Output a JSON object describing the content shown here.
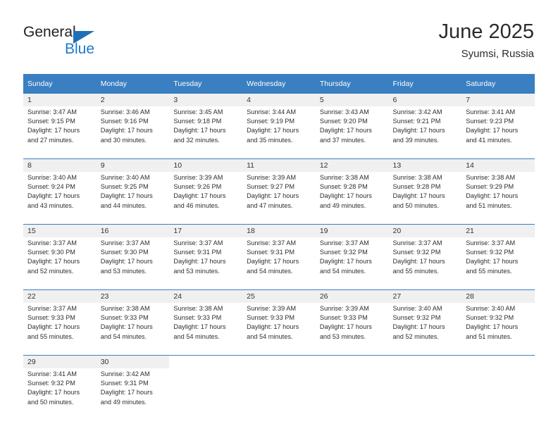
{
  "brand": {
    "name_part1": "General",
    "name_part2": "Blue",
    "flag_icon": "triangle-flag-icon"
  },
  "header": {
    "title": "June 2025",
    "subtitle": "Syumsi, Russia"
  },
  "calendar": {
    "weekday_headers": [
      "Sunday",
      "Monday",
      "Tuesday",
      "Wednesday",
      "Thursday",
      "Friday",
      "Saturday"
    ],
    "accent_color": "#3a7fc1",
    "daynum_bg": "#f0f0f0",
    "weeks": [
      {
        "days": [
          {
            "num": "1",
            "sunrise": "Sunrise: 3:47 AM",
            "sunset": "Sunset: 9:15 PM",
            "daylight1": "Daylight: 17 hours",
            "daylight2": "and 27 minutes."
          },
          {
            "num": "2",
            "sunrise": "Sunrise: 3:46 AM",
            "sunset": "Sunset: 9:16 PM",
            "daylight1": "Daylight: 17 hours",
            "daylight2": "and 30 minutes."
          },
          {
            "num": "3",
            "sunrise": "Sunrise: 3:45 AM",
            "sunset": "Sunset: 9:18 PM",
            "daylight1": "Daylight: 17 hours",
            "daylight2": "and 32 minutes."
          },
          {
            "num": "4",
            "sunrise": "Sunrise: 3:44 AM",
            "sunset": "Sunset: 9:19 PM",
            "daylight1": "Daylight: 17 hours",
            "daylight2": "and 35 minutes."
          },
          {
            "num": "5",
            "sunrise": "Sunrise: 3:43 AM",
            "sunset": "Sunset: 9:20 PM",
            "daylight1": "Daylight: 17 hours",
            "daylight2": "and 37 minutes."
          },
          {
            "num": "6",
            "sunrise": "Sunrise: 3:42 AM",
            "sunset": "Sunset: 9:21 PM",
            "daylight1": "Daylight: 17 hours",
            "daylight2": "and 39 minutes."
          },
          {
            "num": "7",
            "sunrise": "Sunrise: 3:41 AM",
            "sunset": "Sunset: 9:23 PM",
            "daylight1": "Daylight: 17 hours",
            "daylight2": "and 41 minutes."
          }
        ]
      },
      {
        "days": [
          {
            "num": "8",
            "sunrise": "Sunrise: 3:40 AM",
            "sunset": "Sunset: 9:24 PM",
            "daylight1": "Daylight: 17 hours",
            "daylight2": "and 43 minutes."
          },
          {
            "num": "9",
            "sunrise": "Sunrise: 3:40 AM",
            "sunset": "Sunset: 9:25 PM",
            "daylight1": "Daylight: 17 hours",
            "daylight2": "and 44 minutes."
          },
          {
            "num": "10",
            "sunrise": "Sunrise: 3:39 AM",
            "sunset": "Sunset: 9:26 PM",
            "daylight1": "Daylight: 17 hours",
            "daylight2": "and 46 minutes."
          },
          {
            "num": "11",
            "sunrise": "Sunrise: 3:39 AM",
            "sunset": "Sunset: 9:27 PM",
            "daylight1": "Daylight: 17 hours",
            "daylight2": "and 47 minutes."
          },
          {
            "num": "12",
            "sunrise": "Sunrise: 3:38 AM",
            "sunset": "Sunset: 9:28 PM",
            "daylight1": "Daylight: 17 hours",
            "daylight2": "and 49 minutes."
          },
          {
            "num": "13",
            "sunrise": "Sunrise: 3:38 AM",
            "sunset": "Sunset: 9:28 PM",
            "daylight1": "Daylight: 17 hours",
            "daylight2": "and 50 minutes."
          },
          {
            "num": "14",
            "sunrise": "Sunrise: 3:38 AM",
            "sunset": "Sunset: 9:29 PM",
            "daylight1": "Daylight: 17 hours",
            "daylight2": "and 51 minutes."
          }
        ]
      },
      {
        "days": [
          {
            "num": "15",
            "sunrise": "Sunrise: 3:37 AM",
            "sunset": "Sunset: 9:30 PM",
            "daylight1": "Daylight: 17 hours",
            "daylight2": "and 52 minutes."
          },
          {
            "num": "16",
            "sunrise": "Sunrise: 3:37 AM",
            "sunset": "Sunset: 9:30 PM",
            "daylight1": "Daylight: 17 hours",
            "daylight2": "and 53 minutes."
          },
          {
            "num": "17",
            "sunrise": "Sunrise: 3:37 AM",
            "sunset": "Sunset: 9:31 PM",
            "daylight1": "Daylight: 17 hours",
            "daylight2": "and 53 minutes."
          },
          {
            "num": "18",
            "sunrise": "Sunrise: 3:37 AM",
            "sunset": "Sunset: 9:31 PM",
            "daylight1": "Daylight: 17 hours",
            "daylight2": "and 54 minutes."
          },
          {
            "num": "19",
            "sunrise": "Sunrise: 3:37 AM",
            "sunset": "Sunset: 9:32 PM",
            "daylight1": "Daylight: 17 hours",
            "daylight2": "and 54 minutes."
          },
          {
            "num": "20",
            "sunrise": "Sunrise: 3:37 AM",
            "sunset": "Sunset: 9:32 PM",
            "daylight1": "Daylight: 17 hours",
            "daylight2": "and 55 minutes."
          },
          {
            "num": "21",
            "sunrise": "Sunrise: 3:37 AM",
            "sunset": "Sunset: 9:32 PM",
            "daylight1": "Daylight: 17 hours",
            "daylight2": "and 55 minutes."
          }
        ]
      },
      {
        "days": [
          {
            "num": "22",
            "sunrise": "Sunrise: 3:37 AM",
            "sunset": "Sunset: 9:33 PM",
            "daylight1": "Daylight: 17 hours",
            "daylight2": "and 55 minutes."
          },
          {
            "num": "23",
            "sunrise": "Sunrise: 3:38 AM",
            "sunset": "Sunset: 9:33 PM",
            "daylight1": "Daylight: 17 hours",
            "daylight2": "and 54 minutes."
          },
          {
            "num": "24",
            "sunrise": "Sunrise: 3:38 AM",
            "sunset": "Sunset: 9:33 PM",
            "daylight1": "Daylight: 17 hours",
            "daylight2": "and 54 minutes."
          },
          {
            "num": "25",
            "sunrise": "Sunrise: 3:39 AM",
            "sunset": "Sunset: 9:33 PM",
            "daylight1": "Daylight: 17 hours",
            "daylight2": "and 54 minutes."
          },
          {
            "num": "26",
            "sunrise": "Sunrise: 3:39 AM",
            "sunset": "Sunset: 9:33 PM",
            "daylight1": "Daylight: 17 hours",
            "daylight2": "and 53 minutes."
          },
          {
            "num": "27",
            "sunrise": "Sunrise: 3:40 AM",
            "sunset": "Sunset: 9:32 PM",
            "daylight1": "Daylight: 17 hours",
            "daylight2": "and 52 minutes."
          },
          {
            "num": "28",
            "sunrise": "Sunrise: 3:40 AM",
            "sunset": "Sunset: 9:32 PM",
            "daylight1": "Daylight: 17 hours",
            "daylight2": "and 51 minutes."
          }
        ]
      },
      {
        "days": [
          {
            "num": "29",
            "sunrise": "Sunrise: 3:41 AM",
            "sunset": "Sunset: 9:32 PM",
            "daylight1": "Daylight: 17 hours",
            "daylight2": "and 50 minutes."
          },
          {
            "num": "30",
            "sunrise": "Sunrise: 3:42 AM",
            "sunset": "Sunset: 9:31 PM",
            "daylight1": "Daylight: 17 hours",
            "daylight2": "and 49 minutes."
          },
          {
            "num": "",
            "sunrise": "",
            "sunset": "",
            "daylight1": "",
            "daylight2": ""
          },
          {
            "num": "",
            "sunrise": "",
            "sunset": "",
            "daylight1": "",
            "daylight2": ""
          },
          {
            "num": "",
            "sunrise": "",
            "sunset": "",
            "daylight1": "",
            "daylight2": ""
          },
          {
            "num": "",
            "sunrise": "",
            "sunset": "",
            "daylight1": "",
            "daylight2": ""
          },
          {
            "num": "",
            "sunrise": "",
            "sunset": "",
            "daylight1": "",
            "daylight2": ""
          }
        ]
      }
    ]
  }
}
